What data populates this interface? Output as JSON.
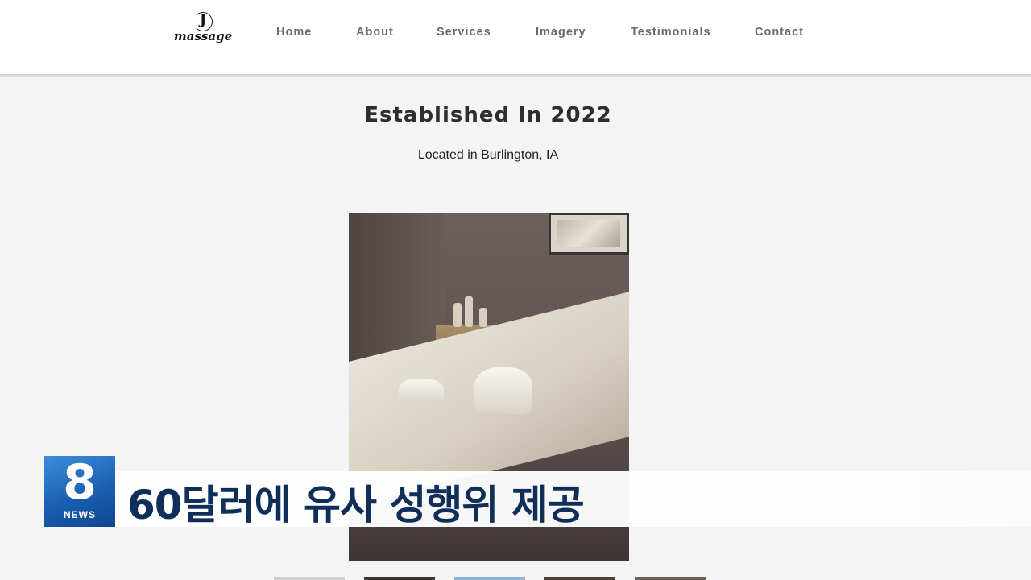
{
  "logo": {
    "letter": "J",
    "word": "massage"
  },
  "nav": {
    "items": [
      {
        "label": "Home"
      },
      {
        "label": "About"
      },
      {
        "label": "Services"
      },
      {
        "label": "Imagery"
      },
      {
        "label": "Testimonials"
      },
      {
        "label": "Contact"
      }
    ]
  },
  "hero": {
    "title": "Established In 2022",
    "subtitle": "Located in Burlington, IA"
  },
  "broadcast": {
    "channel_number": "8",
    "channel_label": "NEWS",
    "headline": "60달러에 유사 성행위 제공"
  },
  "colors": {
    "nav_text": "#6b6b6b",
    "news_blue": "#1b5fb0",
    "headline_navy": "#0f2f5a"
  }
}
